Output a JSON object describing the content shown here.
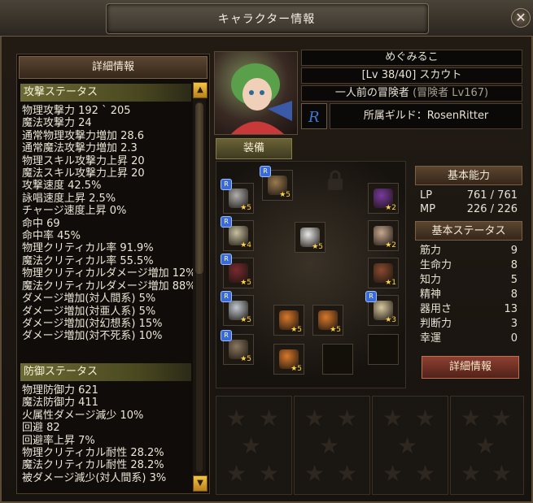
{
  "window": {
    "title": "キャラクター情報",
    "close": "✕"
  },
  "left": {
    "header": "詳細情報",
    "attack_header": "攻撃ステータス",
    "attack": [
      "物理攻撃力 192 ` 205",
      "魔法攻撃力 24",
      "通常物理攻撃力増加 28.6",
      "通常魔法攻撃力増加 2.3",
      "物理スキル攻撃力上昇 20",
      "魔法スキル攻撃力上昇 20",
      "攻撃速度 42.5%",
      "詠唱速度上昇 2.5%",
      "チャージ速度上昇 0%",
      "命中 69",
      "命中率 45%",
      "物理クリティカル率 91.9%",
      "魔法クリティカル率 55.5%",
      "物理クリティカルダメージ増加 12%",
      "魔法クリティカルダメージ増加 88%",
      "ダメージ増加(対人間系) 5%",
      "ダメージ増加(対亜人系) 5%",
      "ダメージ増加(対幻想系) 15%",
      "ダメージ増加(対不死系) 10%"
    ],
    "defense_header": "防御ステータス",
    "defense": [
      "物理防御力 621",
      "魔法防御力 411",
      "火属性ダメージ減少 10%",
      "回避 82",
      "回避率上昇 7%",
      "物理クリティカル耐性 28.2%",
      "魔法クリティカル耐性 28.2%",
      "被ダメージ減少(対人間系) 3%"
    ],
    "scroll_up": "▲",
    "scroll_down": "▼"
  },
  "profile": {
    "name": "めぐみるこ",
    "level_class": "[Lv 38/40] スカウト",
    "rank": "一人前の冒険者",
    "rank_sub": "(冒険者 Lv167)",
    "guild": "所属ギルド：RosenRitter"
  },
  "equip_tab": "装備",
  "equip_slots": [
    {
      "id": "weapon",
      "star": "★5",
      "r": true,
      "color": "#9a7a50"
    },
    {
      "id": "helm",
      "star": "★5",
      "r": true,
      "color": "#b0b0b0"
    },
    {
      "id": "cape",
      "star": "★2",
      "r": false,
      "color": "#7a3aa0"
    },
    {
      "id": "shoulder",
      "star": "★4",
      "r": true,
      "color": "#c8c0a0"
    },
    {
      "id": "pet",
      "star": "★5",
      "r": false,
      "color": "#e8e8e8"
    },
    {
      "id": "chest",
      "star": "★2",
      "r": false,
      "color": "#c8a890"
    },
    {
      "id": "mask",
      "star": "★5",
      "r": true,
      "color": "#7a2a30"
    },
    {
      "id": "belt",
      "star": "★1",
      "r": false,
      "color": "#8a4a30"
    },
    {
      "id": "gloves",
      "star": "★5",
      "r": true,
      "color": "#c0c8d0"
    },
    {
      "id": "ring1",
      "star": "★5",
      "r": false,
      "color": "#d8782a"
    },
    {
      "id": "ring2",
      "star": "★5",
      "r": false,
      "color": "#d8782a"
    },
    {
      "id": "earring",
      "star": "★3",
      "r": true,
      "color": "#d8c8a0"
    },
    {
      "id": "boots",
      "star": "★5",
      "r": true,
      "color": "#8a7860"
    },
    {
      "id": "ring3",
      "star": "★5",
      "r": false,
      "color": "#d8782a"
    }
  ],
  "basic": {
    "header": "基本能力",
    "lp_label": "LP",
    "lp_value": "761 / 761",
    "mp_label": "MP",
    "mp_value": "226 / 226"
  },
  "base_stats": {
    "header": "基本ステータス",
    "rows": [
      {
        "label": "筋力",
        "value": "9"
      },
      {
        "label": "生命力",
        "value": "8"
      },
      {
        "label": "知力",
        "value": "5"
      },
      {
        "label": "精神",
        "value": "8"
      },
      {
        "label": "器用さ",
        "value": "13"
      },
      {
        "label": "判断力",
        "value": "3"
      },
      {
        "label": "幸運",
        "value": "0"
      }
    ]
  },
  "detail_button": "詳細情報"
}
